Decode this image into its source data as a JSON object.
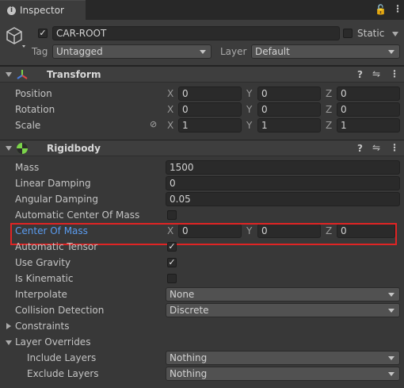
{
  "tab": {
    "label": "Inspector"
  },
  "object": {
    "name": "CAR-ROOT",
    "static_label": "Static",
    "tag_label": "Tag",
    "tag_value": "Untagged",
    "layer_label": "Layer",
    "layer_value": "Default"
  },
  "transform": {
    "title": "Transform",
    "position": {
      "label": "Position",
      "x": "0",
      "y": "0",
      "z": "0"
    },
    "rotation": {
      "label": "Rotation",
      "x": "0",
      "y": "0",
      "z": "0"
    },
    "scale": {
      "label": "Scale",
      "x": "1",
      "y": "1",
      "z": "1"
    }
  },
  "axes": {
    "x": "X",
    "y": "Y",
    "z": "Z"
  },
  "rigidbody": {
    "title": "Rigidbody",
    "mass": {
      "label": "Mass",
      "value": "1500"
    },
    "linear_damping": {
      "label": "Linear Damping",
      "value": "0"
    },
    "angular_damping": {
      "label": "Angular Damping",
      "value": "0.05"
    },
    "auto_com": {
      "label": "Automatic Center Of Mass",
      "checked": false
    },
    "center_of_mass": {
      "label": "Center Of Mass",
      "x": "0",
      "y": "0",
      "z": "0"
    },
    "auto_tensor": {
      "label": "Automatic Tensor",
      "checked": true
    },
    "use_gravity": {
      "label": "Use Gravity",
      "checked": true
    },
    "is_kinematic": {
      "label": "Is Kinematic",
      "checked": false
    },
    "interpolate": {
      "label": "Interpolate",
      "value": "None"
    },
    "collision_detection": {
      "label": "Collision Detection",
      "value": "Discrete"
    },
    "constraints": {
      "label": "Constraints"
    },
    "layer_overrides": {
      "label": "Layer Overrides"
    },
    "include_layers": {
      "label": "Include Layers",
      "value": "Nothing"
    },
    "exclude_layers": {
      "label": "Exclude Layers",
      "value": "Nothing"
    }
  },
  "colors": {
    "highlight": "#e02424",
    "selected_label": "#5b9cf0",
    "background": "#383838"
  }
}
